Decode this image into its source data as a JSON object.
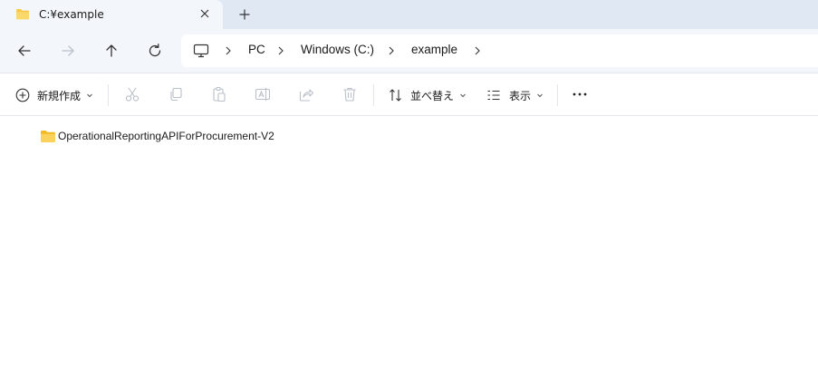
{
  "tab": {
    "title": "C:¥example",
    "close_icon": "close-icon",
    "new_tab_icon": "plus-icon"
  },
  "nav": {
    "back_icon": "arrow-left-icon",
    "forward_icon": "arrow-right-icon",
    "up_icon": "arrow-up-icon",
    "refresh_icon": "refresh-icon"
  },
  "address": {
    "root_icon": "monitor-icon",
    "crumbs": [
      "PC",
      "Windows (C:)",
      "example"
    ]
  },
  "commands": {
    "new_label": "新規作成",
    "sort_label": "並べ替え",
    "view_label": "表示",
    "more_icon": "more-icon"
  },
  "files": [
    {
      "name": "OperationalReportingAPIForProcurement-V2",
      "type": "folder"
    }
  ],
  "colors": {
    "folder": "#f7c948",
    "tab_strip": "#dfe8f3",
    "nav_bg": "#f3f7fb",
    "disabled_icon": "#b9c0c8"
  }
}
